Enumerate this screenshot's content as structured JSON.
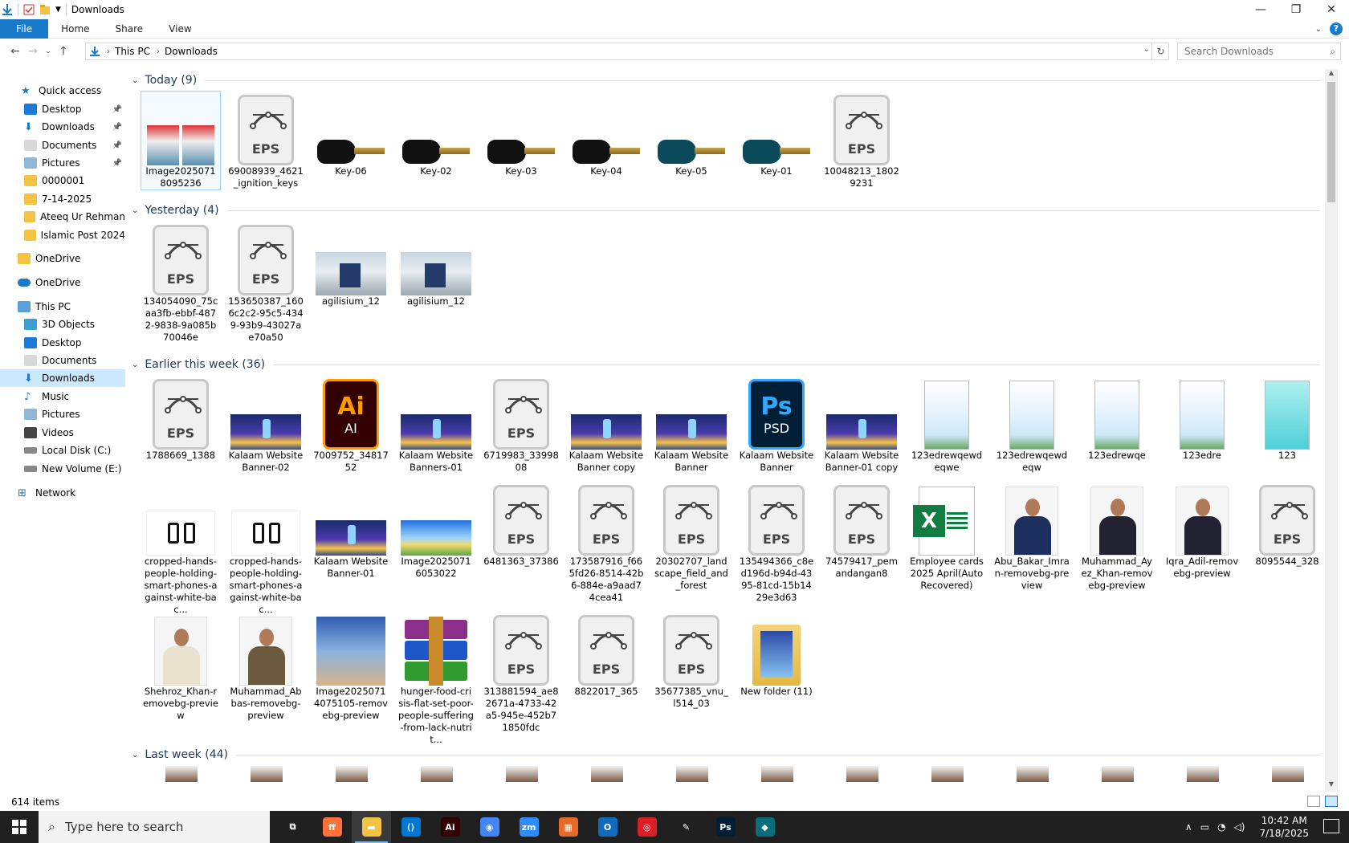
{
  "window": {
    "title": "Downloads",
    "controls": {
      "minimize": "—",
      "maximize": "❐",
      "close": "✕"
    }
  },
  "ribbon": {
    "tabs": [
      "File",
      "Home",
      "Share",
      "View"
    ],
    "help": "?"
  },
  "address": {
    "crumbs": [
      "This PC",
      "Downloads"
    ],
    "search_placeholder": "Search Downloads"
  },
  "sidebar": {
    "items": [
      {
        "label": "Quick access",
        "icon": "star-icon"
      },
      {
        "label": "Desktop",
        "icon": "desktop-icon",
        "pinned": true
      },
      {
        "label": "Downloads",
        "icon": "download-icon",
        "pinned": true
      },
      {
        "label": "Documents",
        "icon": "documents-icon",
        "pinned": true
      },
      {
        "label": "Pictures",
        "icon": "pictures-icon",
        "pinned": true
      },
      {
        "label": "0000001",
        "icon": "folder-icon"
      },
      {
        "label": "7-14-2025",
        "icon": "folder-icon"
      },
      {
        "label": "Ateeq Ur Rehman",
        "icon": "folder-icon"
      },
      {
        "label": "Islamic Post 2024",
        "icon": "folder-icon"
      },
      {
        "label": "OneDrive",
        "icon": "folder-icon"
      },
      {
        "label": "OneDrive",
        "icon": "cloud-icon"
      },
      {
        "label": "This PC",
        "icon": "computer-icon"
      },
      {
        "label": "3D Objects",
        "icon": "3d-objects-icon"
      },
      {
        "label": "Desktop",
        "icon": "desktop-icon"
      },
      {
        "label": "Documents",
        "icon": "documents-icon"
      },
      {
        "label": "Downloads",
        "icon": "download-icon",
        "selected": true
      },
      {
        "label": "Music",
        "icon": "music-icon"
      },
      {
        "label": "Pictures",
        "icon": "pictures-icon"
      },
      {
        "label": "Videos",
        "icon": "videos-icon"
      },
      {
        "label": "Local Disk (C:)",
        "icon": "drive-icon"
      },
      {
        "label": "New Volume (E:)",
        "icon": "drive-icon"
      },
      {
        "label": "Network",
        "icon": "network-icon"
      }
    ]
  },
  "groups": {
    "today": {
      "label": "Today (9)"
    },
    "yesterday": {
      "label": "Yesterday (4)"
    },
    "earlier": {
      "label": "Earlier this week (36)"
    },
    "lastweek": {
      "label": "Last week (44)"
    }
  },
  "files": {
    "today": [
      {
        "name": "Image20250718095236",
        "kind": "photo2"
      },
      {
        "name": "69008939_4621_ignition_keys",
        "kind": "eps"
      },
      {
        "name": "Key-06",
        "kind": "key"
      },
      {
        "name": "Key-02",
        "kind": "key"
      },
      {
        "name": "Key-03",
        "kind": "key"
      },
      {
        "name": "Key-04",
        "kind": "key"
      },
      {
        "name": "Key-05",
        "kind": "key-teal"
      },
      {
        "name": "Key-01",
        "kind": "key-teal"
      },
      {
        "name": "10048213_18029231",
        "kind": "eps"
      }
    ],
    "yesterday": [
      {
        "name": "134054090_75caa3fb-ebbf-4872-9838-9a085b70046e",
        "kind": "eps"
      },
      {
        "name": "153650387_1606c2c2-95c5-4349-93b9-43027ae70a50",
        "kind": "eps"
      },
      {
        "name": "agilisium_12",
        "kind": "cars"
      },
      {
        "name": "agilisium_12",
        "kind": "cars"
      }
    ],
    "earlier_row1": [
      {
        "name": "1788669_1388",
        "kind": "eps"
      },
      {
        "name": "Kalaam Website Banner-02",
        "kind": "banner"
      },
      {
        "name": "7009752_3481752",
        "kind": "ai"
      },
      {
        "name": "Kalaam Website Banners-01",
        "kind": "banner"
      },
      {
        "name": "6719983_3399808",
        "kind": "eps"
      },
      {
        "name": "Kalaam Website Banner copy",
        "kind": "banner"
      },
      {
        "name": "Kalaam Website Banner",
        "kind": "banner"
      },
      {
        "name": "Kalaam Website Banner",
        "kind": "psd"
      },
      {
        "name": "Kalaam Website Banner-01 copy",
        "kind": "banner"
      },
      {
        "name": "123edrewqewdeqwe",
        "kind": "doc"
      },
      {
        "name": "123edrewqewdeqw",
        "kind": "doc"
      },
      {
        "name": "123edrewqe",
        "kind": "doc"
      },
      {
        "name": "123edre",
        "kind": "doc"
      },
      {
        "name": "123",
        "kind": "doc-cyan"
      }
    ],
    "earlier_row2": [
      {
        "name": "cropped-hands-people-holding-smart-phones-against-white-bac...",
        "kind": "hands"
      },
      {
        "name": "cropped-hands-people-holding-smart-phones-against-white-bac...",
        "kind": "hands"
      },
      {
        "name": "Kalaam Website Banner-01",
        "kind": "banner"
      },
      {
        "name": "Image20250716053022",
        "kind": "mosque"
      },
      {
        "name": "6481363_37386",
        "kind": "eps"
      },
      {
        "name": "173587916_f665fd26-8514-42b6-884e-a9aad74cea41",
        "kind": "eps"
      },
      {
        "name": "20302707_landscape_field_and_forest",
        "kind": "eps"
      },
      {
        "name": "135494366_c8ed196d-b94d-4395-81cd-15b1429e3d63",
        "kind": "eps"
      },
      {
        "name": "74579417_pemandangan8",
        "kind": "eps"
      },
      {
        "name": "Employee cards 2025 April(AutoRecovered)",
        "kind": "xls"
      },
      {
        "name": "Abu_Bakar_Imran-removebg-preview",
        "kind": "person-blue"
      },
      {
        "name": "Muhammad_Ayez_Khan-removebg-preview",
        "kind": "person"
      },
      {
        "name": "Iqra_Adil-removebg-preview",
        "kind": "person"
      },
      {
        "name": "8095544_328",
        "kind": "eps"
      }
    ],
    "earlier_row3": [
      {
        "name": "Shehroz_Khan-removebg-preview",
        "kind": "person-cream"
      },
      {
        "name": "Muhammad_Abbas-removebg-preview",
        "kind": "person-olive"
      },
      {
        "name": "Image20250714075105-removebg-preview",
        "kind": "girl"
      },
      {
        "name": "hunger-food-crisis-flat-set-poor-people-suffering-from-lack-nutrit...",
        "kind": "rar"
      },
      {
        "name": "313881594_ae82671a-4733-42a5-945e-452b71850fdc",
        "kind": "eps"
      },
      {
        "name": "8822017_365",
        "kind": "eps"
      },
      {
        "name": "35677385_vnu_l514_03",
        "kind": "eps"
      },
      {
        "name": "New folder (11)",
        "kind": "folder"
      }
    ]
  },
  "labels": {
    "eps": "EPS",
    "ai_big": "Ai",
    "ai_small": "AI",
    "psd_big": "Ps",
    "psd_small": "PSD",
    "xls_letter": "X"
  },
  "status": {
    "count": "614 items"
  },
  "taskbar": {
    "search_placeholder": "Type here to search",
    "apps": [
      {
        "name": "task-view",
        "color": "#202020",
        "glyph": "⧉"
      },
      {
        "name": "firefox",
        "color": "#ff7139",
        "glyph": "ff"
      },
      {
        "name": "file-explorer",
        "color": "#f3c344",
        "glyph": "▬",
        "active": true
      },
      {
        "name": "vscode",
        "color": "#0078d4",
        "glyph": "⟨⟩"
      },
      {
        "name": "illustrator",
        "color": "#330000",
        "glyph": "Ai"
      },
      {
        "name": "chrome",
        "color": "#4285f4",
        "glyph": "◉"
      },
      {
        "name": "zoom",
        "color": "#2d8cff",
        "glyph": "zm"
      },
      {
        "name": "winrar",
        "color": "#e46b2a",
        "glyph": "▦"
      },
      {
        "name": "outlook",
        "color": "#0f6cbd",
        "glyph": "O"
      },
      {
        "name": "creative-cloud",
        "color": "#da1f26",
        "glyph": "◎"
      },
      {
        "name": "pen-tool",
        "color": "#202020",
        "glyph": "✎"
      },
      {
        "name": "photoshop",
        "color": "#001e36",
        "glyph": "Ps"
      },
      {
        "name": "app-teal",
        "color": "#0a6d7a",
        "glyph": "◆"
      }
    ],
    "time": "10:42 AM",
    "date": "7/18/2025"
  }
}
